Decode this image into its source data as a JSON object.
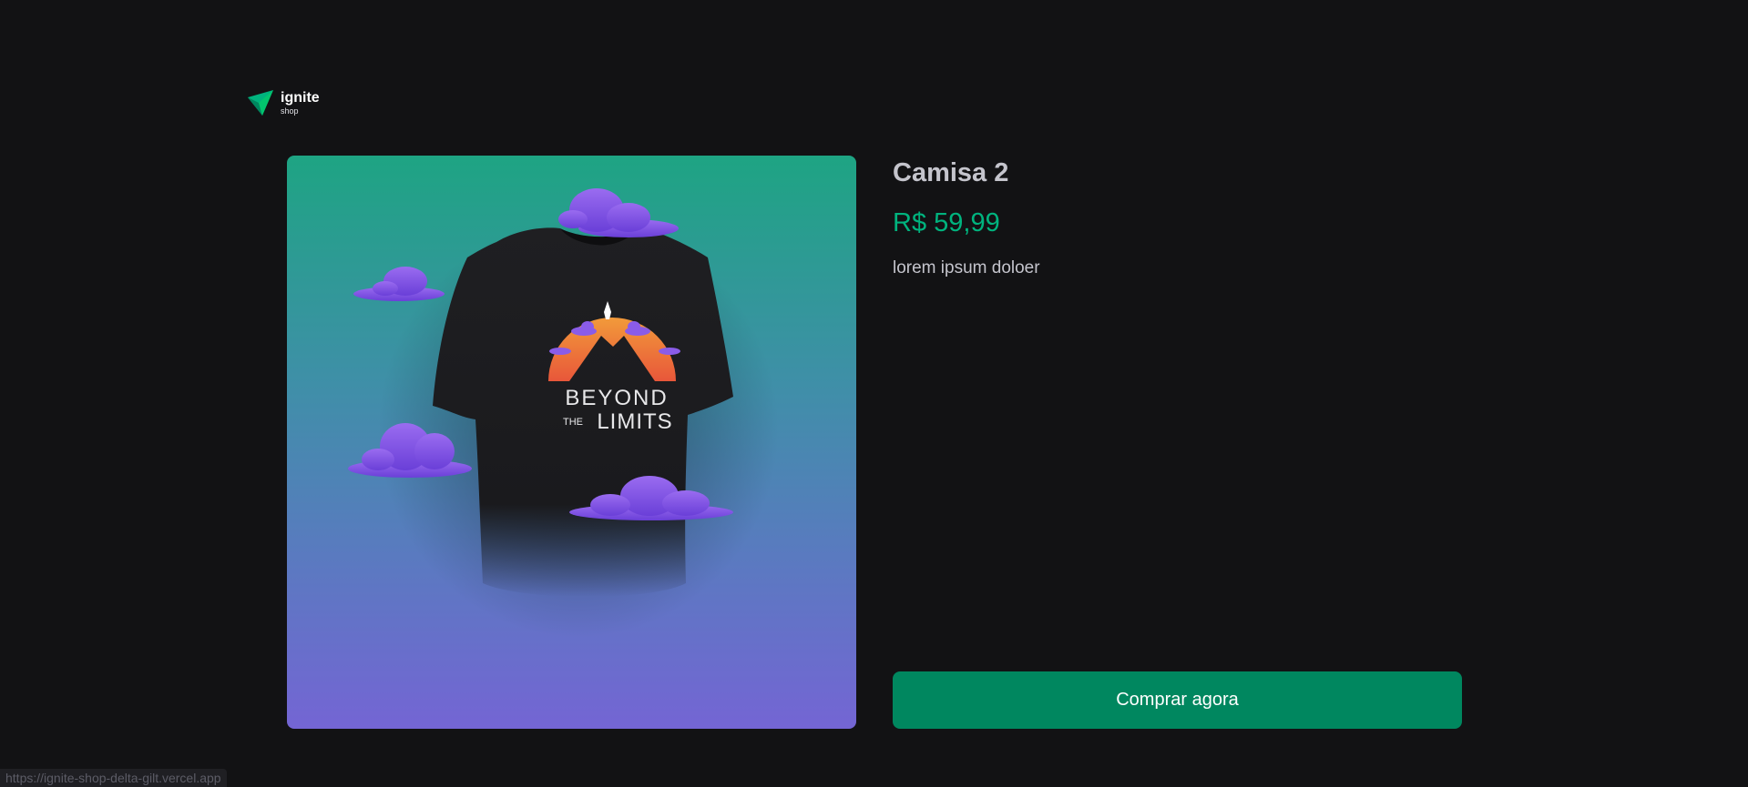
{
  "header": {
    "logo_name": "ignite",
    "logo_sub": "shop"
  },
  "product": {
    "image_icon": "tshirt-product-image",
    "title": "Camisa 2",
    "price": "R$ 59,99",
    "description": "lorem ipsum doloer",
    "buy_label": "Comprar agora",
    "shirt_print_line1": "BEYOND",
    "shirt_print_line2": "THE",
    "shirt_print_line3": "LIMITS"
  },
  "status_bar": {
    "url": "https://ignite-shop-delta-gilt.vercel.app"
  },
  "colors": {
    "background": "#121214",
    "accent": "#00875f",
    "price": "#00b37e",
    "text": "#c4c4cc"
  }
}
